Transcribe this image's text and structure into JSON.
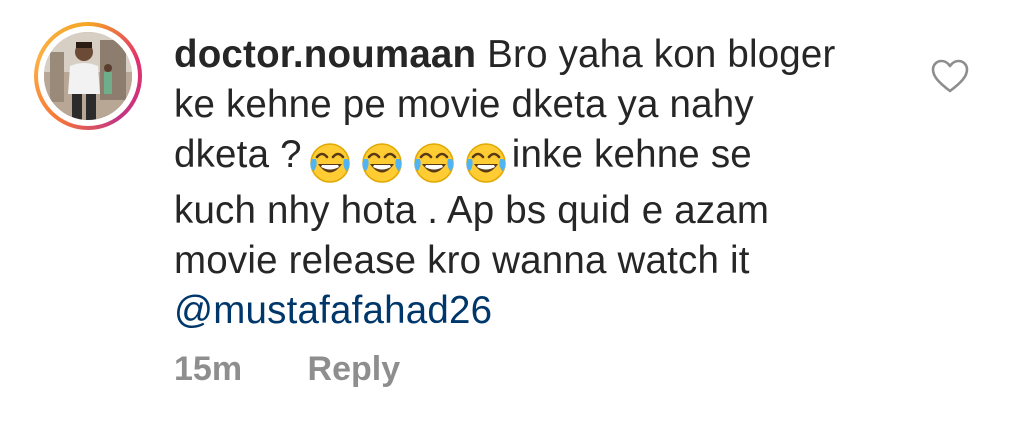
{
  "comment": {
    "username": "doctor.noumaan",
    "text_lines": [
      "Bro yaha kon bloger",
      "ke kehne pe movie dketa ya nahy",
      "dketa ?",
      "inke kehne se",
      "kuch nhy hota . Ap bs quid e azam",
      "movie release kro wanna watch it"
    ],
    "mention": "@mustafafahad26",
    "emojis": [
      "face-with-tears-of-joy",
      "face-with-tears-of-joy",
      "face-with-tears-of-joy",
      "face-with-tears-of-joy"
    ],
    "timestamp": "15m",
    "reply_label": "Reply"
  },
  "icons": {
    "like": "heart-outline-icon",
    "avatar": "user-avatar"
  },
  "colors": {
    "text": "#262626",
    "muted": "#8e8e8e",
    "mention": "#00376b",
    "story_ring_start": "#f5a623",
    "story_ring_end": "#e1306c"
  }
}
